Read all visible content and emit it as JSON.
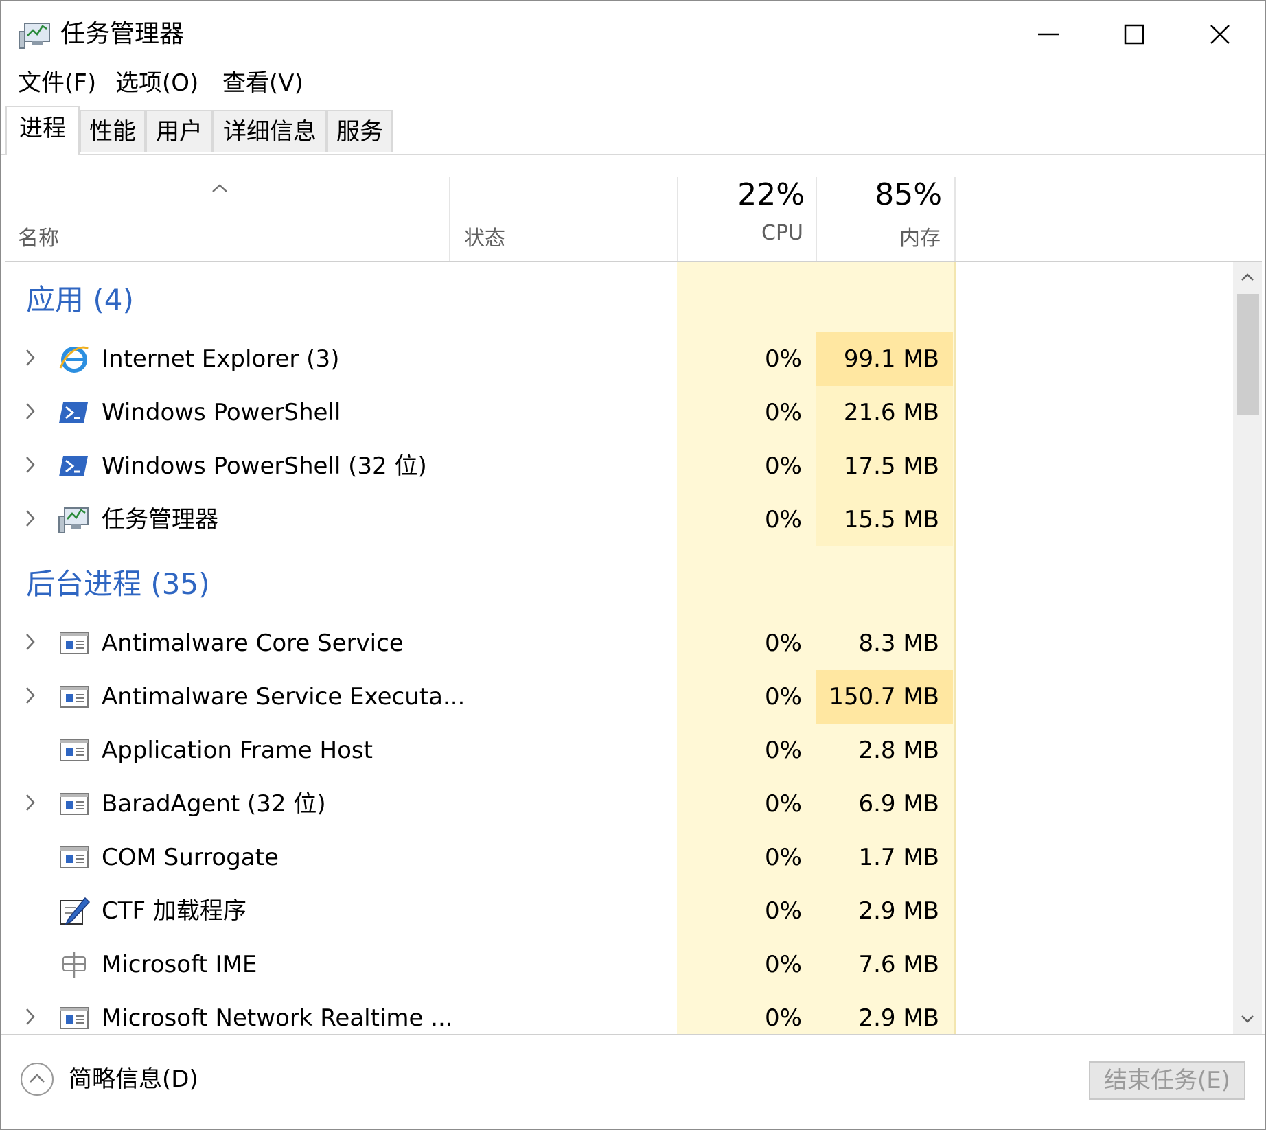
{
  "window": {
    "title": "任务管理器"
  },
  "menu": [
    "文件(F)",
    "选项(O)",
    "查看(V)"
  ],
  "tabs": [
    "进程",
    "性能",
    "用户",
    "详细信息",
    "服务"
  ],
  "columns": {
    "name": "名称",
    "status": "状态",
    "cpu_pct": "22%",
    "cpu": "CPU",
    "mem_pct": "85%",
    "mem": "内存"
  },
  "groups": {
    "apps": "应用 (4)",
    "background": "后台进程 (35)"
  },
  "apps": [
    {
      "name": "Internet Explorer (3)",
      "icon": "ie-icon",
      "cpu": "0%",
      "mem": "99.1 MB",
      "expandable": true
    },
    {
      "name": "Windows PowerShell",
      "icon": "powershell-icon",
      "cpu": "0%",
      "mem": "21.6 MB",
      "expandable": true
    },
    {
      "name": "Windows PowerShell (32 位)",
      "icon": "powershell-icon",
      "cpu": "0%",
      "mem": "17.5 MB",
      "expandable": true
    },
    {
      "name": "任务管理器",
      "icon": "task-manager-icon",
      "cpu": "0%",
      "mem": "15.5 MB",
      "expandable": true
    }
  ],
  "background": [
    {
      "name": "Antimalware Core Service",
      "icon": "service-window-icon",
      "cpu": "0%",
      "mem": "8.3 MB",
      "expandable": true
    },
    {
      "name": "Antimalware Service Executa...",
      "icon": "service-window-icon",
      "cpu": "0%",
      "mem": "150.7 MB",
      "expandable": true
    },
    {
      "name": "Application Frame Host",
      "icon": "service-window-icon",
      "cpu": "0%",
      "mem": "2.8 MB",
      "expandable": false
    },
    {
      "name": "BaradAgent (32 位)",
      "icon": "service-window-icon",
      "cpu": "0%",
      "mem": "6.9 MB",
      "expandable": true
    },
    {
      "name": "COM Surrogate",
      "icon": "service-window-icon",
      "cpu": "0%",
      "mem": "1.7 MB",
      "expandable": false
    },
    {
      "name": "CTF 加载程序",
      "icon": "pen-edit-icon",
      "cpu": "0%",
      "mem": "2.9 MB",
      "expandable": false
    },
    {
      "name": "Microsoft IME",
      "icon": "ime-icon",
      "cpu": "0%",
      "mem": "7.6 MB",
      "expandable": false
    },
    {
      "name": "Microsoft Network Realtime ...",
      "icon": "service-window-icon",
      "cpu": "0%",
      "mem": "2.9 MB",
      "expandable": true
    }
  ],
  "footer": {
    "details_toggle": "简略信息(D)",
    "end_task": "结束任务(E)"
  },
  "colors": {
    "accent": "#2f66c2",
    "column_highlight": "#fff8d6",
    "memory_high": "#ffe7a1"
  }
}
